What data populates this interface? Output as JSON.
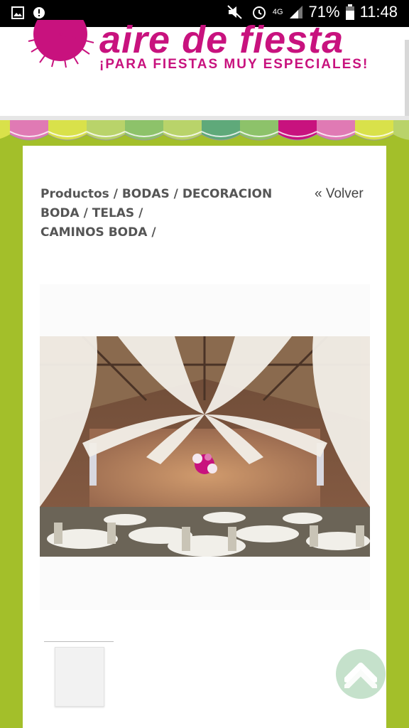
{
  "status_bar": {
    "battery": "71%",
    "time": "11:48",
    "network": "4G"
  },
  "header": {
    "brand": "aire de fiesta",
    "tagline": "¡PARA FIESTAS MUY ESPECIALES!"
  },
  "breadcrumb": {
    "productos": "Productos",
    "bodas": "BODAS",
    "decoracion": "DECORACION BODA",
    "telas": "TELAS",
    "caminos": "CAMINOS BODA",
    "separator": " / "
  },
  "back_link": "« Volver",
  "colors": {
    "brand": "#c8127e",
    "background": "#a3bf2a",
    "awning": [
      "#c8127e",
      "#e07ab4",
      "#d9e14a",
      "#b9d36a",
      "#8dc26a",
      "#5fa97a",
      "#8dc26a",
      "#c8127e",
      "#e07ab4",
      "#d9e14a"
    ]
  },
  "icons": {
    "gallery": "image-icon",
    "notification": "notification-icon",
    "mute": "mute-icon",
    "alarm": "alarm-icon",
    "signal": "signal-icon",
    "battery": "battery-icon",
    "scroll_top": "chevron-up-icon"
  }
}
